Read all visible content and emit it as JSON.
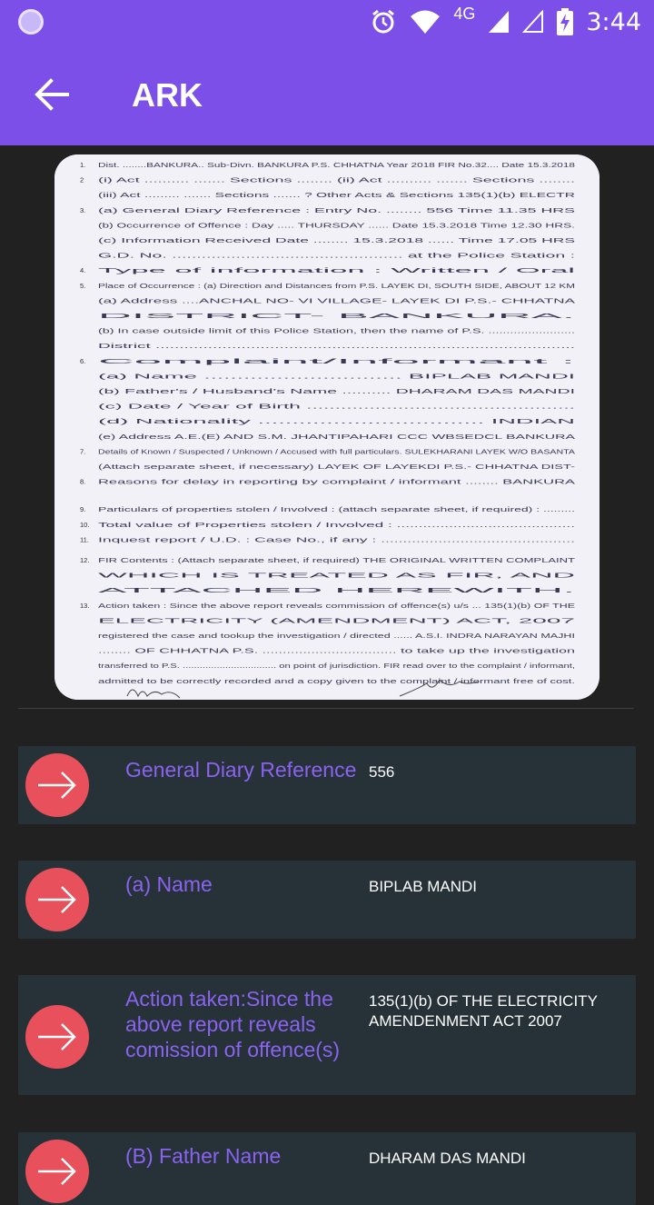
{
  "status_bar": {
    "network": "4G",
    "time": "3:44",
    "icons": [
      "app-icon",
      "alarm-icon",
      "wifi-icon",
      "signal-icon",
      "signal-empty-icon",
      "battery-charging-icon"
    ]
  },
  "app_bar": {
    "title": "ARK",
    "back_icon": "arrow-back-icon"
  },
  "document": {
    "type": "scanned-fir-form",
    "lines": [
      {
        "n": "1.",
        "text": "Dist. ........BANKURA.. Sub-Divn. BANKURA P.S. CHHATNA Year 2018  FIR No.32.... Date 15.3.2018"
      },
      {
        "n": "2",
        "text": "(i) Act ..........     ....... Sections ........      (ii) Act ..........       ....... Sections ........"
      },
      {
        "n": "",
        "text": "(iii) Act ......... ....... Sections ....... ?       Other Acts & Sections 135(1)(b) ELECTR"
      },
      {
        "n": "3.",
        "text": "(a) General Diary Reference : Entry No. ........ 556                         Time 11.35 HRS"
      },
      {
        "n": "",
        "text": "(b) Occurrence of Offence : Day ..... THURSDAY ......   Date 15.3.2018  Time 12.30 HRS."
      },
      {
        "n": "",
        "text": "(c) Information Received Date ........ 15.3.2018 ......                  Time 17.05 HRS"
      },
      {
        "n": "",
        "text": "G.D. No. ...............................................  at the Police Station :"
      },
      {
        "n": "4.",
        "text": "Type of information : Written / Oral"
      },
      {
        "n": "5.",
        "text": "Place of Occurrence : (a) Direction and Distances from P.S. LAYEK DI, SOUTH SIDE, ABOUT 12 KM"
      },
      {
        "n": "",
        "text": "(a) Address ....ANCHAL NO- VI  VILLAGE- LAYEK DI   P.S.- CHHATNA"
      },
      {
        "n": "",
        "text": "             DISTRICT- BANKURA."
      },
      {
        "n": "",
        "text": "(b) In case outside limit of this Police Station, then the name of P.S. ........................"
      },
      {
        "n": "",
        "text": "District ........................................................................................"
      },
      {
        "n": "6.",
        "text": "Complaint/Informant :"
      },
      {
        "n": "",
        "text": "(a) Name ..............................   BIPLAB MANDI"
      },
      {
        "n": "",
        "text": "(b) Father's / Husband's Name ..........   DHARAM DAS MANDI"
      },
      {
        "n": "",
        "text": "(c) Date / Year of Birth ..............................................."
      },
      {
        "n": "",
        "text": "(d) Nationality ................................. INDIAN"
      },
      {
        "n": "",
        "text": "(e) Address A.E.(E) AND S.M. JHANTIPAHARI CCC WBSEDCL BANKURA"
      },
      {
        "n": "7.",
        "text": "Details of Known / Suspected / Unknown / Accused with full particulars. SULEKHARANI  LAYEK W/O BASANTA"
      },
      {
        "n": "",
        "text": "(Attach separate sheet, if necessary)        LAYEK OF LAYEKDI  P.S.- CHHATNA DIST-"
      },
      {
        "n": "8.",
        "text": "Reasons for delay in reporting by complaint / informant ........ BANKURA"
      },
      {
        "n": "9.",
        "text": "Particulars of properties stolen / Involved : (attach separate sheet, if required) : ........."
      },
      {
        "n": "10.",
        "text": "Total value of Properties stolen / Involved : ........................................."
      },
      {
        "n": "11.",
        "text": "Inquest report / U.D. : Case No., if any : ............................................"
      },
      {
        "n": "12.",
        "text": "FIR Contents : (Attach separate sheet, if required)  THE ORIGINAL WRITTEN COMPLAINT"
      },
      {
        "n": "",
        "text": "                                             WHICH IS TREATED AS FIR, AND"
      },
      {
        "n": "",
        "text": "                                             ATTACHED HEREWITH."
      },
      {
        "n": "13.",
        "text": "Action taken : Since the above report reveals commission of offence(s) u/s ... 135(1)(b) OF THE"
      },
      {
        "n": "",
        "text": "        ELECTRICITY (AMENDMENT) ACT, 2007"
      },
      {
        "n": "",
        "text": "registered the case and tookup the investigation / directed ...... A.S.I. INDRA NARAYAN MAJHI"
      },
      {
        "n": "",
        "text": "........ OF CHHATNA P.S. ................................. to take up the investigation"
      },
      {
        "n": "",
        "text": "transferred to P.S. ................................. on point of jurisdiction. FIR read over to the complaint / informant,"
      },
      {
        "n": "",
        "text": "admitted to be correctly recorded and a copy given to the complaint / informant free of cost."
      }
    ]
  },
  "fields": [
    {
      "icon": "arrow-right-icon",
      "label": "General Diary Reference",
      "value": "556"
    },
    {
      "icon": "arrow-right-icon",
      "label": "(a) Name",
      "value": "BIPLAB MANDI"
    },
    {
      "icon": "arrow-right-icon",
      "label": "Action taken:Since the above report reveals comission of offence(s)",
      "value": "135(1)(b) OF THE ELECTRICITY AMENDENMENT ACT 2007"
    },
    {
      "icon": "arrow-right-icon",
      "label": "(B) Father Name",
      "value": "DHARAM DAS MANDI"
    }
  ],
  "colors": {
    "primary": "#7b4fe8",
    "background": "#212121",
    "card": "#263238",
    "accent_text": "#8a63f0",
    "arrow_circle": "#e8505b"
  }
}
